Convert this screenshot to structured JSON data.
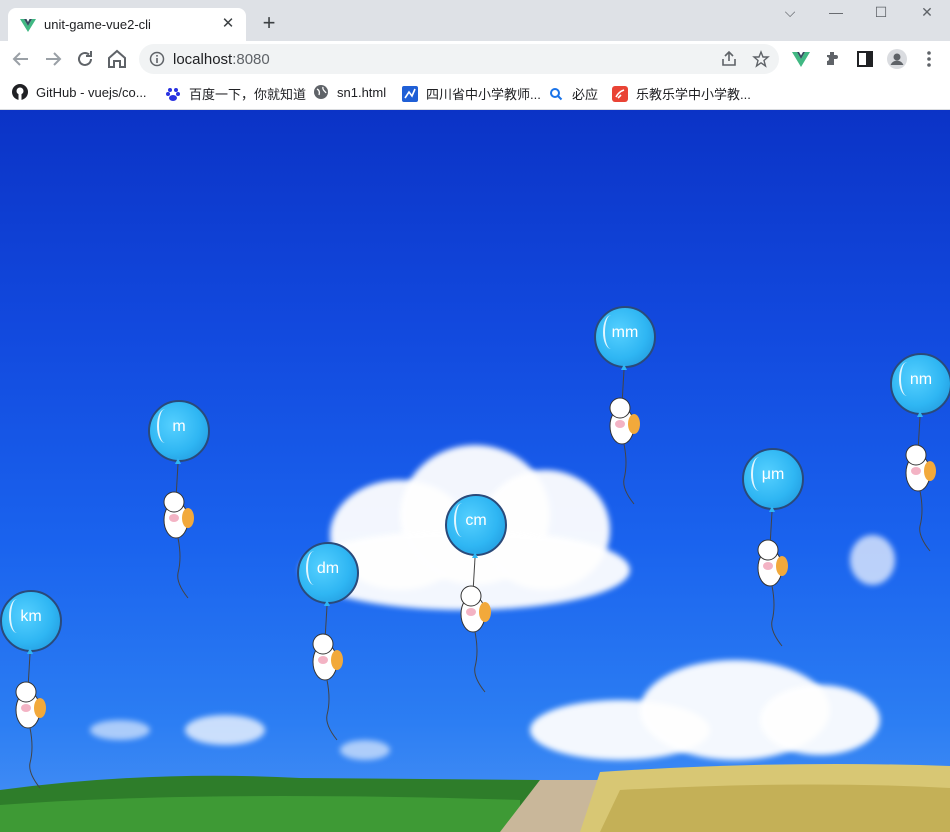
{
  "browser": {
    "tab_title": "unit-game-vue2-cli",
    "tab_close": "✕",
    "new_tab": "+",
    "url_host": "localhost",
    "url_port": ":8080",
    "window_controls": [
      "⌵",
      "—",
      "☐",
      "✕"
    ]
  },
  "bookmarks": [
    {
      "label": "GitHub - vuejs/co...",
      "icon": "github-icon"
    },
    {
      "label": "百度一下，你就知道",
      "icon": "baidu-icon"
    },
    {
      "label": "sn1.html",
      "icon": "globe-icon"
    },
    {
      "label": "四川省中小学教师...",
      "icon": "site-icon"
    },
    {
      "label": "必应",
      "icon": "search-icon"
    },
    {
      "label": "乐教乐学中小学教...",
      "icon": "site-red-icon"
    }
  ],
  "game": {
    "balloons": [
      {
        "unit": "km"
      },
      {
        "unit": "m"
      },
      {
        "unit": "dm"
      },
      {
        "unit": "cm"
      },
      {
        "unit": "mm"
      },
      {
        "unit": "μm"
      },
      {
        "unit": "nm"
      }
    ]
  },
  "colors": {
    "sky_top": "#0b33c6",
    "sky_bottom": "#4a92f4",
    "balloon": "#2fb6f3",
    "grass": "#2e7d2a",
    "wheat": "#d8c774"
  }
}
